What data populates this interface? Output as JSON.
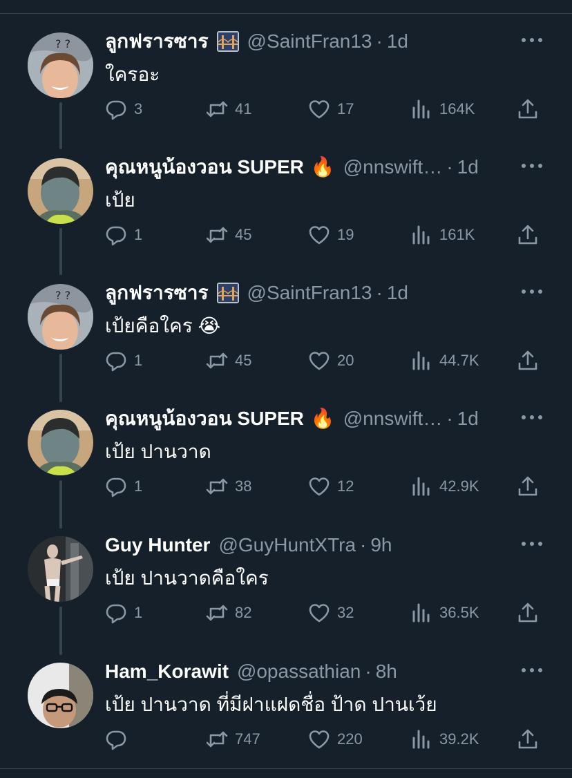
{
  "tweets": [
    {
      "name": "ลูกฟรารซาร",
      "badge": "bridge-emoji",
      "handle": "@SaintFran13",
      "time": "1d",
      "text": "ใครอะ",
      "replies": "3",
      "retweets": "41",
      "likes": "17",
      "views": "164K",
      "avatar": "girl-avatar"
    },
    {
      "name": "คุณหนูน้องวอน SUPER",
      "badge": "🔥",
      "handle": "@nnswift…",
      "time": "1d",
      "text": "เป้ย",
      "replies": "1",
      "retweets": "45",
      "likes": "19",
      "views": "161K",
      "avatar": "mask-avatar"
    },
    {
      "name": "ลูกฟรารซาร",
      "badge": "bridge-emoji",
      "handle": "@SaintFran13",
      "time": "1d",
      "text": "เป้ยคือใคร 😭",
      "replies": "1",
      "retweets": "45",
      "likes": "20",
      "views": "44.7K",
      "avatar": "girl-avatar"
    },
    {
      "name": "คุณหนูน้องวอน SUPER",
      "badge": "🔥",
      "handle": "@nnswift…",
      "time": "1d",
      "text": "เป้ย ปานวาด",
      "replies": "1",
      "retweets": "38",
      "likes": "12",
      "views": "42.9K",
      "avatar": "mask-avatar"
    },
    {
      "name": "Guy Hunter",
      "badge": "",
      "handle": "@GuyHuntXTra",
      "time": "9h",
      "text": "เป้ย ปานวาดคือใคร",
      "replies": "1",
      "retweets": "82",
      "likes": "32",
      "views": "36.5K",
      "avatar": "man-avatar"
    },
    {
      "name": "Ham_Korawit",
      "badge": "",
      "handle": "@opassathian",
      "time": "8h",
      "text": "เป้ย ปานวาด ที่มีฝาแฝดชื่อ ป้าด ปานเว้ย",
      "replies": "",
      "retweets": "747",
      "likes": "220",
      "views": "39.2K",
      "avatar": "glasses-avatar"
    }
  ],
  "colors": {
    "background": "#15202b",
    "muted": "#8b98a5",
    "divider": "#38444d",
    "text": "#ffffff"
  }
}
